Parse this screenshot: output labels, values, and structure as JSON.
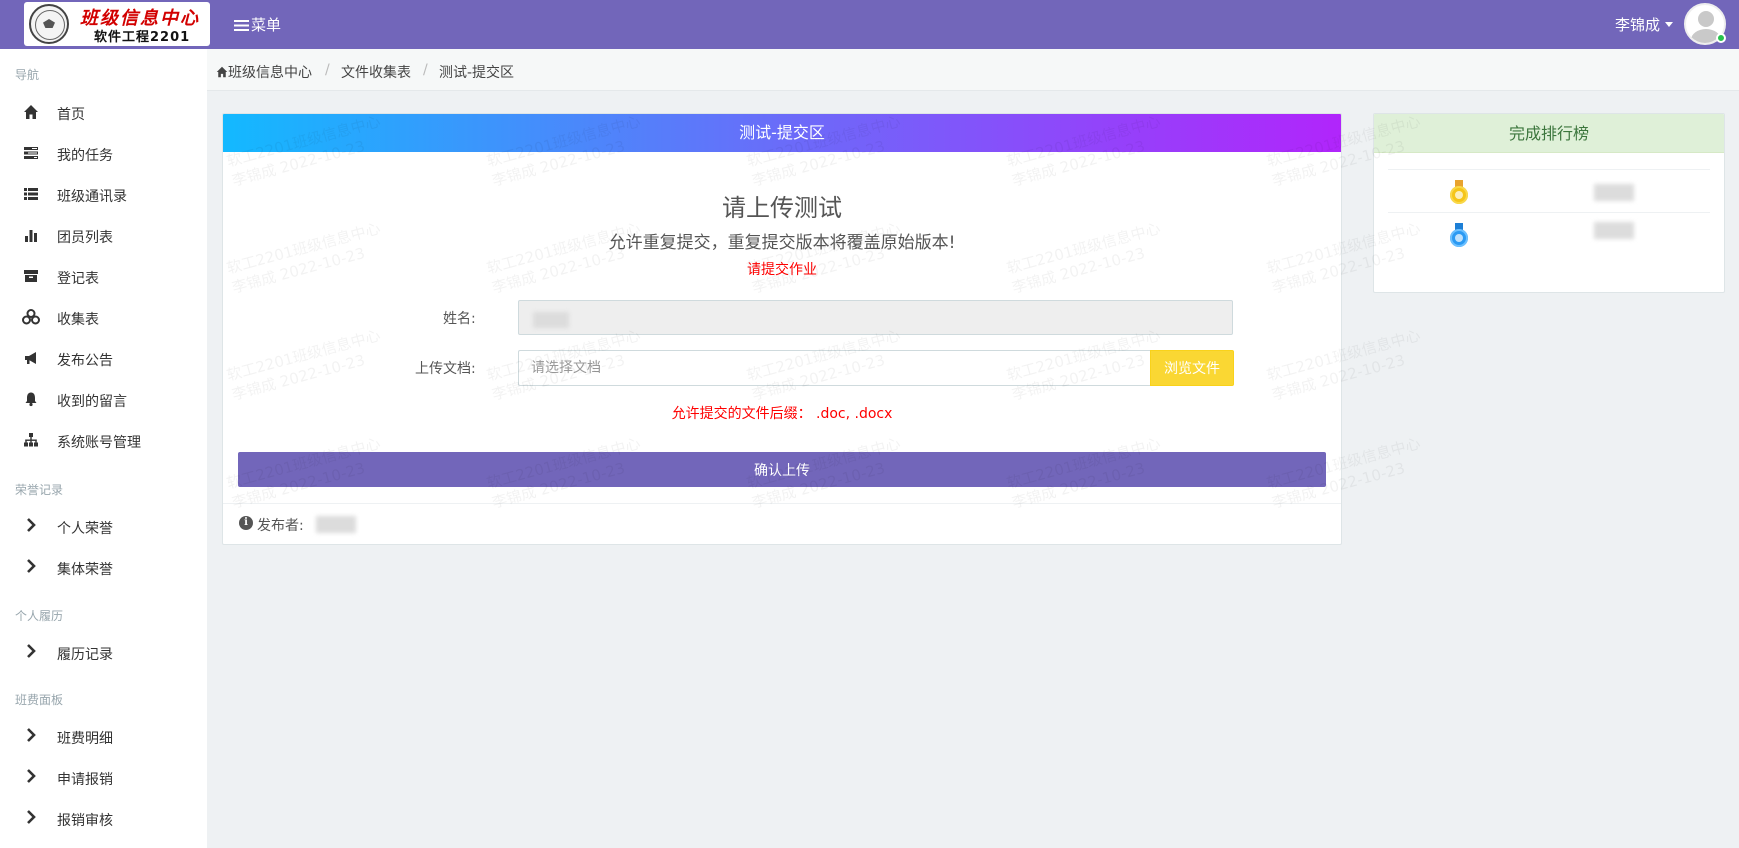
{
  "header": {
    "logo_title": "班级信息中心",
    "logo_subtitle": "软件工程2201",
    "menu_label": "菜单",
    "user_name": "李锦成",
    "status_color": "#27c24c",
    "accent_color": "#7266ba"
  },
  "sidebar": {
    "sections": [
      {
        "title": "导航"
      },
      {
        "title": "荣誉记录"
      },
      {
        "title": "个人履历"
      },
      {
        "title": "班费面板"
      }
    ],
    "items": [
      {
        "label": "首页",
        "icon": "home-icon"
      },
      {
        "label": "我的任务",
        "icon": "tasks-icon"
      },
      {
        "label": "班级通讯录",
        "icon": "list-icon"
      },
      {
        "label": "团员列表",
        "icon": "bar-chart-icon"
      },
      {
        "label": "登记表",
        "icon": "archive-icon"
      },
      {
        "label": "收集表",
        "icon": "cubes-icon"
      },
      {
        "label": "发布公告",
        "icon": "bullhorn-icon"
      },
      {
        "label": "收到的留言",
        "icon": "bell-icon"
      },
      {
        "label": "系统账号管理",
        "icon": "sitemap-icon"
      },
      {
        "label": "个人荣誉",
        "icon": "chevron-right-icon"
      },
      {
        "label": "集体荣誉",
        "icon": "chevron-right-icon"
      },
      {
        "label": "履历记录",
        "icon": "chevron-right-icon"
      },
      {
        "label": "班费明细",
        "icon": "chevron-right-icon"
      },
      {
        "label": "申请报销",
        "icon": "chevron-right-icon"
      },
      {
        "label": "报销审核",
        "icon": "chevron-right-icon"
      }
    ]
  },
  "breadcrumb": [
    "班级信息中心",
    "文件收集表",
    "测试-提交区"
  ],
  "panel": {
    "title": "测试-提交区",
    "heading": "请上传测试",
    "note": "允许重复提交，重复提交版本将覆盖原始版本!",
    "status": "请提交作业",
    "name_label": "姓名:",
    "file_label": "上传文档:",
    "file_placeholder": "请选择文档",
    "browse_label": "浏览文件",
    "suffix_note": "允许提交的文件后缀： .doc, .docx",
    "confirm_label": "确认上传",
    "publisher_label": "发布者:"
  },
  "ranking": {
    "title": "完成排行榜",
    "entries": [
      {
        "medal": "gold-medal-icon"
      },
      {
        "medal": "blue-medal-icon"
      }
    ]
  },
  "watermark": {
    "line1": "软工2201班级信息中心",
    "line2": "李锦成 2022-10-23"
  }
}
